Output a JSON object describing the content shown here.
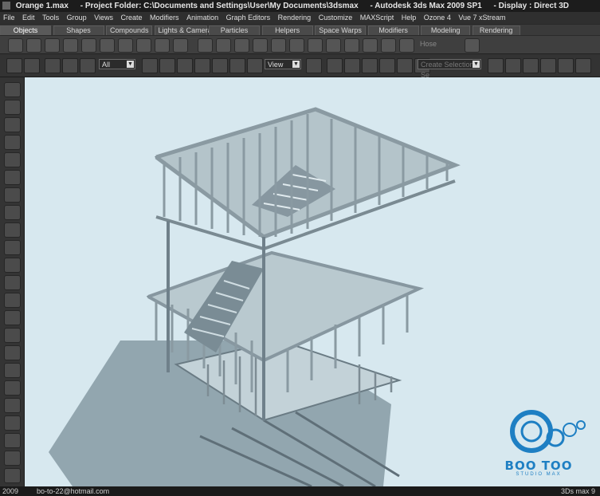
{
  "window": {
    "title_segments": [
      "Orange 1.max",
      "- Project Folder: C:\\Documents and Settings\\User\\My Documents\\3dsmax",
      "- Autodesk 3ds Max  2009 SP1",
      "- Display : Direct 3D"
    ]
  },
  "menu": {
    "items": [
      "File",
      "Edit",
      "Tools",
      "Group",
      "Views",
      "Create",
      "Modifiers",
      "Animation",
      "Graph Editors",
      "Rendering",
      "Customize",
      "MAXScript",
      "Help",
      "Ozone 4",
      "Vue 7 xStream"
    ]
  },
  "tabs": {
    "items": [
      {
        "label": "Objects",
        "active": true
      },
      {
        "label": "Shapes",
        "active": false
      },
      {
        "label": "Compounds",
        "active": false
      },
      {
        "label": "Lights & Cameras",
        "active": false
      },
      {
        "label": "Particles",
        "active": false
      },
      {
        "label": "Helpers",
        "active": false
      },
      {
        "label": "Space Warps",
        "active": false
      },
      {
        "label": "Modifiers",
        "active": false
      },
      {
        "label": "Modeling",
        "active": false
      },
      {
        "label": "Rendering",
        "active": false
      }
    ]
  },
  "shelf": {
    "hose_label": "Hose"
  },
  "toolbar": {
    "selection_filter": "All",
    "reference_coord": "View",
    "named_selection_placeholder": "Create Selection Se"
  },
  "viewport": {
    "background": "#d7e8ef",
    "scene_color": "#c8d8de"
  },
  "branding": {
    "name": "BOO TOO",
    "tagline": "STUDIO MAX",
    "accent": "#1e7fc3"
  },
  "status": {
    "year": "2009",
    "email": "bo-to-22@hotmail.com",
    "product": "3Ds max 9"
  }
}
